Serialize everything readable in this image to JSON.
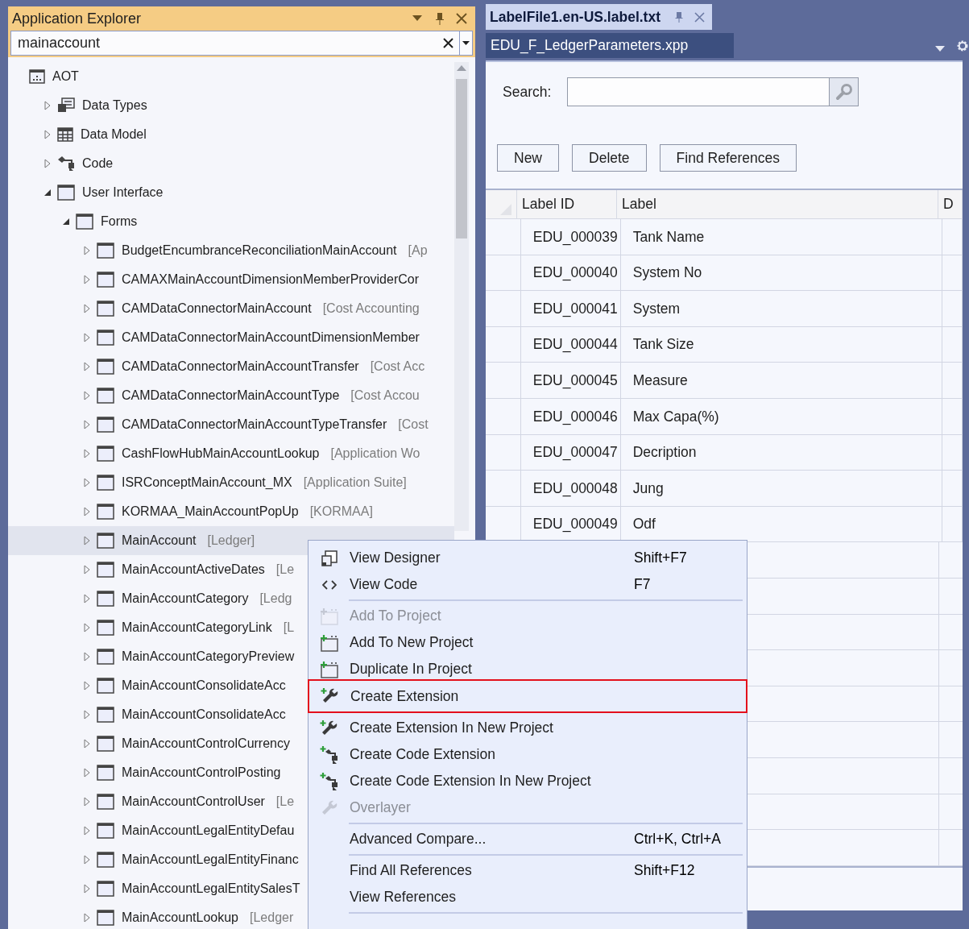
{
  "explorer": {
    "title": "Application Explorer",
    "search": {
      "value": "mainaccount"
    },
    "tree": [
      {
        "label": "AOT",
        "kind": "root",
        "children": [
          {
            "label": "Data Types",
            "kind": "types",
            "expanded": false
          },
          {
            "label": "Data Model",
            "kind": "model",
            "expanded": false
          },
          {
            "label": "Code",
            "kind": "code",
            "expanded": false
          },
          {
            "label": "User Interface",
            "kind": "form",
            "expanded": true,
            "children": [
              {
                "label": "Forms",
                "kind": "form",
                "expanded": true,
                "children": [
                  {
                    "label": "BudgetEncumbranceReconciliationMainAccount",
                    "module": "[Ap",
                    "kind": "form",
                    "expanded": false,
                    "selected": false
                  },
                  {
                    "label": "CAMAXMainAccountDimensionMemberProviderCor",
                    "kind": "form",
                    "expanded": false,
                    "selected": false
                  },
                  {
                    "label": "CAMDataConnectorMainAccount",
                    "module": "[Cost Accounting",
                    "kind": "form",
                    "expanded": false,
                    "selected": false
                  },
                  {
                    "label": "CAMDataConnectorMainAccountDimensionMember",
                    "kind": "form",
                    "expanded": false,
                    "selected": false
                  },
                  {
                    "label": "CAMDataConnectorMainAccountTransfer",
                    "module": "[Cost Acc",
                    "kind": "form",
                    "expanded": false,
                    "selected": false
                  },
                  {
                    "label": "CAMDataConnectorMainAccountType",
                    "module": "[Cost Accou",
                    "kind": "form",
                    "expanded": false,
                    "selected": false
                  },
                  {
                    "label": "CAMDataConnectorMainAccountTypeTransfer",
                    "module": "[Cost",
                    "kind": "form",
                    "expanded": false,
                    "selected": false
                  },
                  {
                    "label": "CashFlowHubMainAccountLookup",
                    "module": "[Application Wo",
                    "kind": "form",
                    "expanded": false,
                    "selected": false
                  },
                  {
                    "label": "ISRConceptMainAccount_MX",
                    "module": "[Application Suite]",
                    "kind": "form",
                    "expanded": false,
                    "selected": false
                  },
                  {
                    "label": "KORMAA_MainAccountPopUp",
                    "module": "[KORMAA]",
                    "kind": "form",
                    "expanded": false,
                    "selected": false
                  },
                  {
                    "label": "MainAccount",
                    "module": "[Ledger]",
                    "kind": "form",
                    "expanded": false,
                    "selected": true
                  },
                  {
                    "label": "MainAccountActiveDates",
                    "module": "[Le",
                    "kind": "form",
                    "expanded": false,
                    "selected": false
                  },
                  {
                    "label": "MainAccountCategory",
                    "module": "[Ledg",
                    "kind": "form",
                    "expanded": false,
                    "selected": false
                  },
                  {
                    "label": "MainAccountCategoryLink",
                    "module": "[L",
                    "kind": "form",
                    "expanded": false,
                    "selected": false
                  },
                  {
                    "label": "MainAccountCategoryPreview",
                    "kind": "form",
                    "expanded": false,
                    "selected": false
                  },
                  {
                    "label": "MainAccountConsolidateAcc",
                    "kind": "form",
                    "expanded": false,
                    "selected": false
                  },
                  {
                    "label": "MainAccountConsolidateAcc",
                    "kind": "form",
                    "expanded": false,
                    "selected": false
                  },
                  {
                    "label": "MainAccountControlCurrency",
                    "kind": "form",
                    "expanded": false,
                    "selected": false
                  },
                  {
                    "label": "MainAccountControlPosting",
                    "kind": "form",
                    "expanded": false,
                    "selected": false
                  },
                  {
                    "label": "MainAccountControlUser",
                    "module": "[Le",
                    "kind": "form",
                    "expanded": false,
                    "selected": false
                  },
                  {
                    "label": "MainAccountLegalEntityDefau",
                    "kind": "form",
                    "expanded": false,
                    "selected": false
                  },
                  {
                    "label": "MainAccountLegalEntityFinanc",
                    "kind": "form",
                    "expanded": false,
                    "selected": false
                  },
                  {
                    "label": "MainAccountLegalEntitySalesT",
                    "kind": "form",
                    "expanded": false,
                    "selected": false
                  },
                  {
                    "label": "MainAccountLookup",
                    "module": "[Ledger",
                    "kind": "form",
                    "expanded": false,
                    "selected": false
                  }
                ]
              }
            ]
          }
        ]
      }
    ]
  },
  "editor": {
    "tabs": [
      {
        "label": "LabelFile1.en-US.label.txt",
        "selected": true
      },
      {
        "label": "EDU_F_LedgerParameters.xpp",
        "selected": false
      }
    ],
    "search_label": "Search:",
    "buttons": [
      "New",
      "Delete",
      "Find References"
    ],
    "table": {
      "columns": [
        "Label ID",
        "Label",
        "D"
      ],
      "rows": [
        [
          "EDU_000039",
          "Tank Name"
        ],
        [
          "EDU_000040",
          "System No"
        ],
        [
          "EDU_000041",
          "System"
        ],
        [
          "EDU_000044",
          "Tank Size"
        ],
        [
          "EDU_000045",
          "Measure"
        ],
        [
          "EDU_000046",
          "Max Capa(%)"
        ],
        [
          "EDU_000047",
          "Decription"
        ],
        [
          "EDU_000048",
          "Jung"
        ],
        [
          "EDU_000049",
          "Odf"
        ]
      ]
    }
  },
  "context_menu": [
    {
      "kind": "item",
      "label": "View Designer",
      "shortcut": "Shift+F7",
      "disabled": false,
      "highlighted": false
    },
    {
      "kind": "item",
      "label": "View Code",
      "shortcut": "F7",
      "disabled": false,
      "highlighted": false
    },
    {
      "kind": "separator"
    },
    {
      "kind": "item",
      "label": "Add To Project",
      "disabled": true,
      "highlighted": false
    },
    {
      "kind": "item",
      "label": "Add To New Project",
      "disabled": false,
      "highlighted": false
    },
    {
      "kind": "item",
      "label": "Duplicate In Project",
      "disabled": false,
      "highlighted": false
    },
    {
      "kind": "item",
      "label": "Create Extension",
      "disabled": false,
      "highlighted": true
    },
    {
      "kind": "item",
      "label": "Create Extension In New Project",
      "disabled": false,
      "highlighted": false
    },
    {
      "kind": "item",
      "label": "Create Code Extension",
      "disabled": false,
      "highlighted": false
    },
    {
      "kind": "item",
      "label": "Create Code Extension In New Project",
      "disabled": false,
      "highlighted": false
    },
    {
      "kind": "item",
      "label": "Overlayer",
      "disabled": true,
      "highlighted": false
    },
    {
      "kind": "separator"
    },
    {
      "kind": "item",
      "label": "Advanced Compare...",
      "shortcut": "Ctrl+K, Ctrl+A",
      "disabled": false,
      "highlighted": false
    },
    {
      "kind": "separator"
    },
    {
      "kind": "item",
      "label": "Find All References",
      "shortcut": "Shift+F12",
      "disabled": false,
      "highlighted": false
    },
    {
      "kind": "item",
      "label": "View References",
      "disabled": false,
      "highlighted": false
    },
    {
      "kind": "separator"
    }
  ]
}
